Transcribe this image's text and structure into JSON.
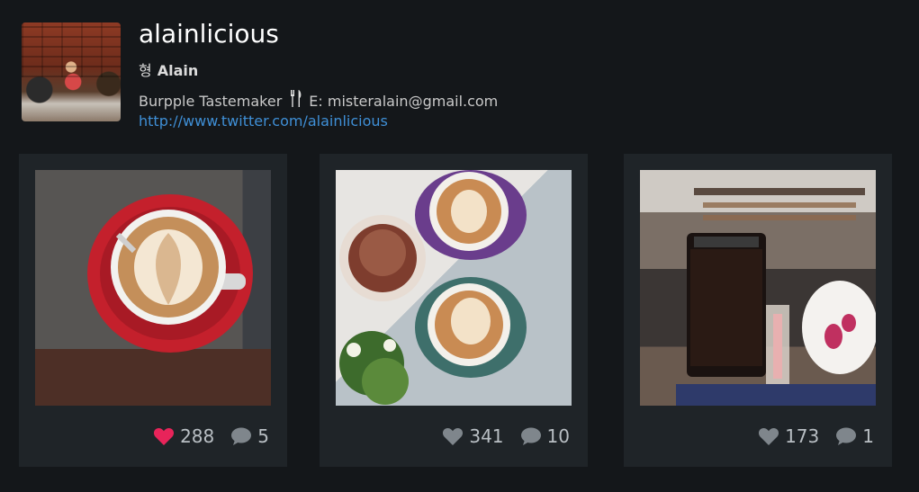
{
  "profile": {
    "username": "alainlicious",
    "korean_glyph": "형",
    "display_name": "Alain",
    "title": "Burpple Tastemaker",
    "email_text": "E: misteralain@gmail.com",
    "link": "http://www.twitter.com/alainlicious",
    "fork_icon": "fork-knife-icon"
  },
  "posts": [
    {
      "likes": "288",
      "comments": "5",
      "liked": true
    },
    {
      "likes": "341",
      "comments": "10",
      "liked": false
    },
    {
      "likes": "173",
      "comments": "1",
      "liked": false
    }
  ],
  "colors": {
    "background": "#14171a",
    "card": "#1f2428",
    "link": "#3f8fd6",
    "heart_active": "#e8245a",
    "icon_inactive": "#7f868c"
  }
}
